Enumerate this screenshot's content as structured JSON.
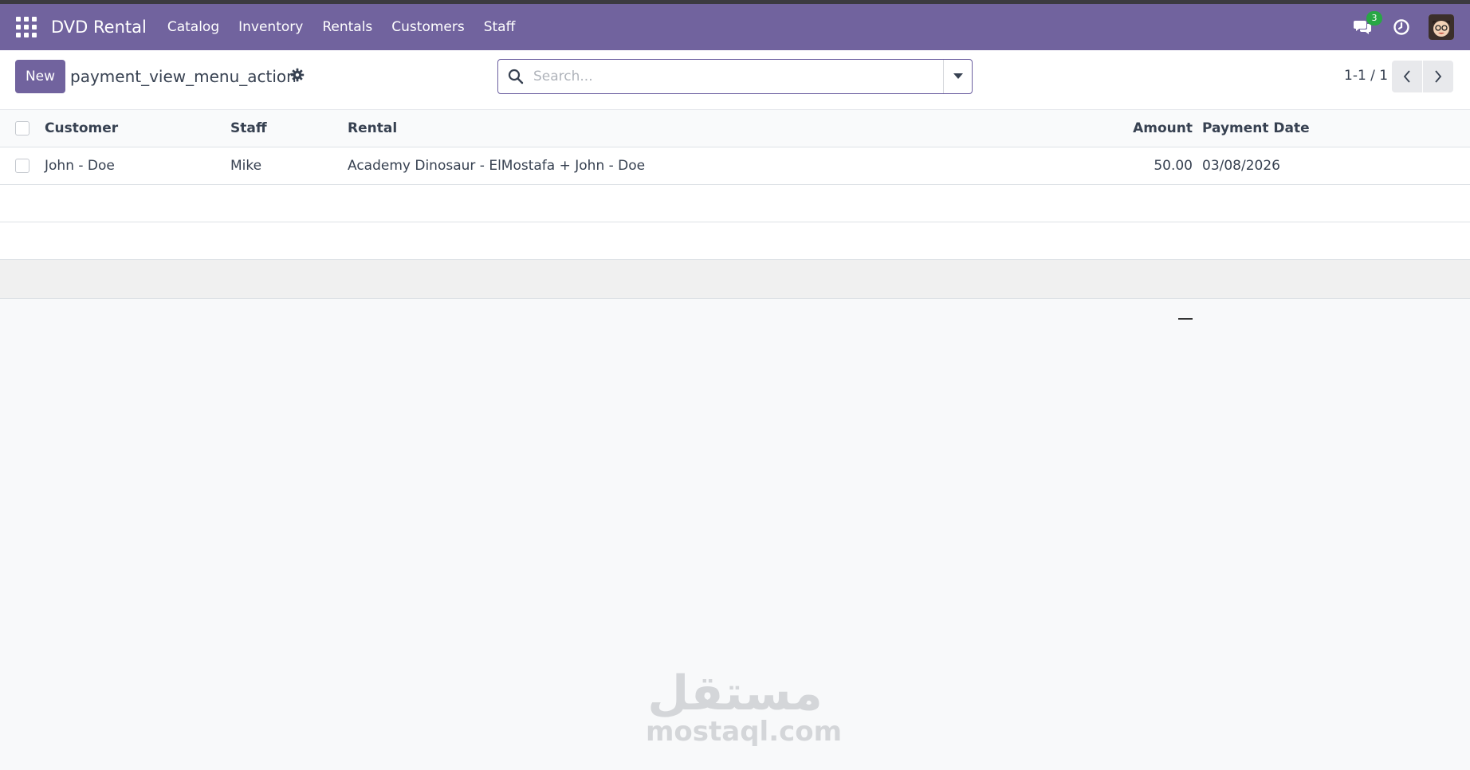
{
  "navbar": {
    "brand": "DVD Rental",
    "menu": [
      "Catalog",
      "Inventory",
      "Rentals",
      "Customers",
      "Staff"
    ],
    "message_count": "3"
  },
  "control": {
    "new_label": "New",
    "title": "payment_view_menu_action",
    "search_placeholder": "Search...",
    "pager": "1-1 / 1"
  },
  "table": {
    "columns": [
      "Customer",
      "Staff",
      "Rental",
      "Amount",
      "Payment Date"
    ],
    "rows": [
      {
        "customer": "John - Doe",
        "staff": "Mike",
        "rental": "Academy Dinosaur - ElMostafa + John - Doe",
        "amount": "50.00",
        "payment_date": "03/08/2026"
      }
    ]
  },
  "watermark": {
    "arabic": "مستقل",
    "latin": "mostaql.com"
  },
  "colors": {
    "brand": "#71639e",
    "badge": "#28a745"
  }
}
